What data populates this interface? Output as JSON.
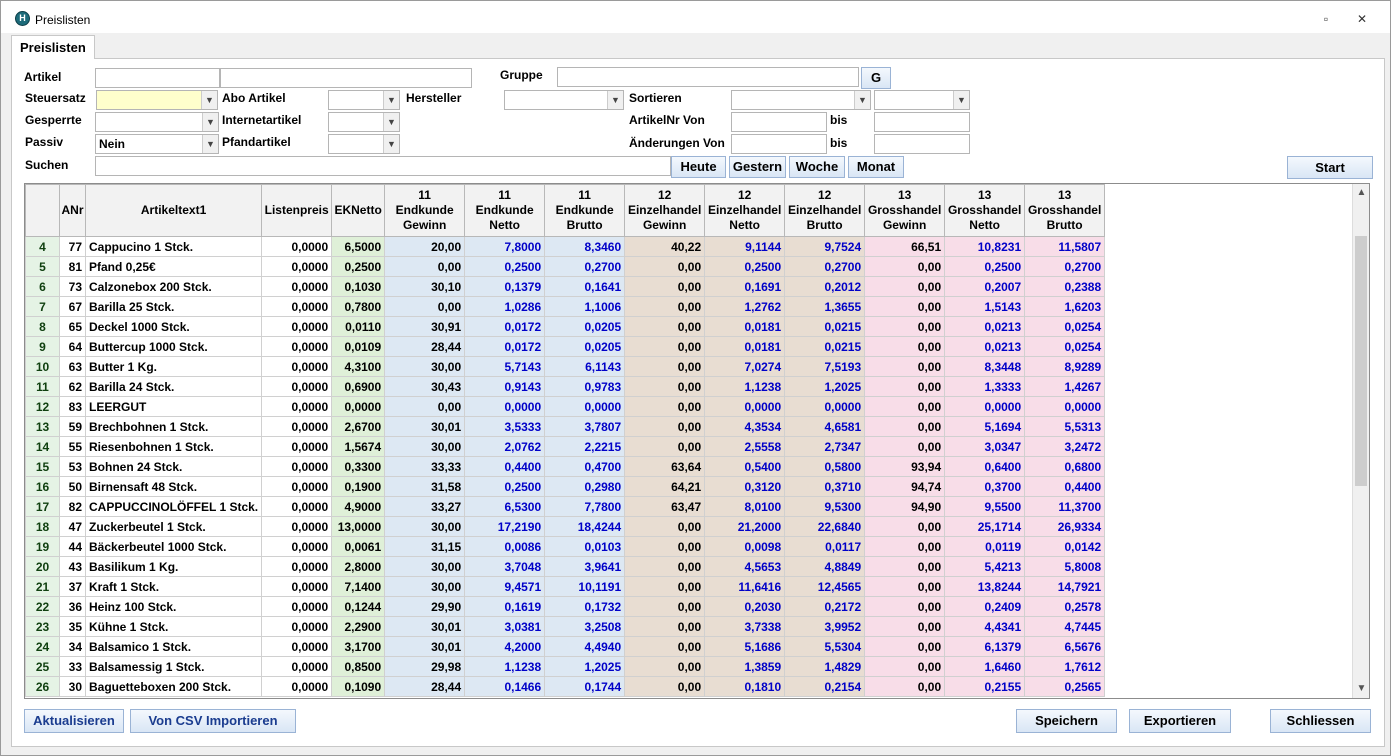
{
  "window": {
    "title": "Preislisten",
    "app_icon": "H"
  },
  "tabs": [
    {
      "label": "Preislisten"
    }
  ],
  "filters": {
    "artikel_label": "Artikel",
    "gruppe_label": "Gruppe",
    "g_button": "G",
    "steuersatz_label": "Steuersatz",
    "abo_artikel_label": "Abo Artikel",
    "hersteller_label": "Hersteller",
    "sortieren_label": "Sortieren",
    "gesperrte_label": "Gesperrte",
    "internetartikel_label": "Internetartikel",
    "artikelnr_von_label": "ArtikelNr Von",
    "bis_label_1": "bis",
    "passiv_label": "Passiv",
    "passiv_value": "Nein",
    "pfandartikel_label": "Pfandartikel",
    "aenderungen_von_label": "Änderungen Von",
    "bis_label_2": "bis",
    "suchen_label": "Suchen",
    "heute": "Heute",
    "gestern": "Gestern",
    "woche": "Woche",
    "monat": "Monat",
    "start": "Start"
  },
  "table": {
    "headers": [
      [
        "ANr"
      ],
      [
        "Artikeltext1"
      ],
      [
        "Listenpreis"
      ],
      [
        "EKNetto"
      ],
      [
        "11",
        "Endkunde",
        "Gewinn"
      ],
      [
        "11",
        "Endkunde",
        "Netto"
      ],
      [
        "11",
        "Endkunde",
        "Brutto"
      ],
      [
        "12",
        "Einzelhandel",
        "Gewinn"
      ],
      [
        "12",
        "Einzelhandel",
        "Netto"
      ],
      [
        "12",
        "Einzelhandel",
        "Brutto"
      ],
      [
        "13",
        "Grosshandel",
        "Gewinn"
      ],
      [
        "13",
        "Grosshandel",
        "Netto"
      ],
      [
        "13",
        "Grosshandel",
        "Brutto"
      ]
    ],
    "rows": [
      [
        "4",
        "77",
        "Cappucino 1 Stck.",
        "0,0000",
        "6,5000",
        "20,00",
        "7,8000",
        "8,3460",
        "40,22",
        "9,1144",
        "9,7524",
        "66,51",
        "10,8231",
        "11,5807"
      ],
      [
        "5",
        "81",
        "Pfand 0,25€",
        "0,0000",
        "0,2500",
        "0,00",
        "0,2500",
        "0,2700",
        "0,00",
        "0,2500",
        "0,2700",
        "0,00",
        "0,2500",
        "0,2700"
      ],
      [
        "6",
        "73",
        "Calzonebox 200 Stck.",
        "0,0000",
        "0,1030",
        "30,10",
        "0,1379",
        "0,1641",
        "0,00",
        "0,1691",
        "0,2012",
        "0,00",
        "0,2007",
        "0,2388"
      ],
      [
        "7",
        "67",
        "Barilla 25 Stck.",
        "0,0000",
        "0,7800",
        "0,00",
        "1,0286",
        "1,1006",
        "0,00",
        "1,2762",
        "1,3655",
        "0,00",
        "1,5143",
        "1,6203"
      ],
      [
        "8",
        "65",
        "Deckel 1000 Stck.",
        "0,0000",
        "0,0110",
        "30,91",
        "0,0172",
        "0,0205",
        "0,00",
        "0,0181",
        "0,0215",
        "0,00",
        "0,0213",
        "0,0254"
      ],
      [
        "9",
        "64",
        "Buttercup 1000 Stck.",
        "0,0000",
        "0,0109",
        "28,44",
        "0,0172",
        "0,0205",
        "0,00",
        "0,0181",
        "0,0215",
        "0,00",
        "0,0213",
        "0,0254"
      ],
      [
        "10",
        "63",
        "Butter 1 Kg.",
        "0,0000",
        "4,3100",
        "30,00",
        "5,7143",
        "6,1143",
        "0,00",
        "7,0274",
        "7,5193",
        "0,00",
        "8,3448",
        "8,9289"
      ],
      [
        "11",
        "62",
        "Barilla 24 Stck.",
        "0,0000",
        "0,6900",
        "30,43",
        "0,9143",
        "0,9783",
        "0,00",
        "1,1238",
        "1,2025",
        "0,00",
        "1,3333",
        "1,4267"
      ],
      [
        "12",
        "83",
        "LEERGUT",
        "0,0000",
        "0,0000",
        "0,00",
        "0,0000",
        "0,0000",
        "0,00",
        "0,0000",
        "0,0000",
        "0,00",
        "0,0000",
        "0,0000"
      ],
      [
        "13",
        "59",
        "Brechbohnen 1 Stck.",
        "0,0000",
        "2,6700",
        "30,01",
        "3,5333",
        "3,7807",
        "0,00",
        "4,3534",
        "4,6581",
        "0,00",
        "5,1694",
        "5,5313"
      ],
      [
        "14",
        "55",
        "Riesenbohnen 1 Stck.",
        "0,0000",
        "1,5674",
        "30,00",
        "2,0762",
        "2,2215",
        "0,00",
        "2,5558",
        "2,7347",
        "0,00",
        "3,0347",
        "3,2472"
      ],
      [
        "15",
        "53",
        "Bohnen 24 Stck.",
        "0,0000",
        "0,3300",
        "33,33",
        "0,4400",
        "0,4700",
        "63,64",
        "0,5400",
        "0,5800",
        "93,94",
        "0,6400",
        "0,6800"
      ],
      [
        "16",
        "50",
        "Birnensaft 48 Stck.",
        "0,0000",
        "0,1900",
        "31,58",
        "0,2500",
        "0,2980",
        "64,21",
        "0,3120",
        "0,3710",
        "94,74",
        "0,3700",
        "0,4400"
      ],
      [
        "17",
        "82",
        "CAPPUCCINOLÖFFEL 1 Stck.",
        "0,0000",
        "4,9000",
        "33,27",
        "6,5300",
        "7,7800",
        "63,47",
        "8,0100",
        "9,5300",
        "94,90",
        "9,5500",
        "11,3700"
      ],
      [
        "18",
        "47",
        "Zuckerbeutel 1 Stck.",
        "0,0000",
        "13,0000",
        "30,00",
        "17,2190",
        "18,4244",
        "0,00",
        "21,2000",
        "22,6840",
        "0,00",
        "25,1714",
        "26,9334"
      ],
      [
        "19",
        "44",
        "Bäckerbeutel 1000 Stck.",
        "0,0000",
        "0,0061",
        "31,15",
        "0,0086",
        "0,0103",
        "0,00",
        "0,0098",
        "0,0117",
        "0,00",
        "0,0119",
        "0,0142"
      ],
      [
        "20",
        "43",
        "Basilikum 1 Kg.",
        "0,0000",
        "2,8000",
        "30,00",
        "3,7048",
        "3,9641",
        "0,00",
        "4,5653",
        "4,8849",
        "0,00",
        "5,4213",
        "5,8008"
      ],
      [
        "21",
        "37",
        "Kraft 1 Stck.",
        "0,0000",
        "7,1400",
        "30,00",
        "9,4571",
        "10,1191",
        "0,00",
        "11,6416",
        "12,4565",
        "0,00",
        "13,8244",
        "14,7921"
      ],
      [
        "22",
        "36",
        "Heinz 100 Stck.",
        "0,0000",
        "0,1244",
        "29,90",
        "0,1619",
        "0,1732",
        "0,00",
        "0,2030",
        "0,2172",
        "0,00",
        "0,2409",
        "0,2578"
      ],
      [
        "23",
        "35",
        "Kühne 1 Stck.",
        "0,0000",
        "2,2900",
        "30,01",
        "3,0381",
        "3,2508",
        "0,00",
        "3,7338",
        "3,9952",
        "0,00",
        "4,4341",
        "4,7445"
      ],
      [
        "24",
        "34",
        "Balsamico 1 Stck.",
        "0,0000",
        "3,1700",
        "30,01",
        "4,2000",
        "4,4940",
        "0,00",
        "5,1686",
        "5,5304",
        "0,00",
        "6,1379",
        "6,5676"
      ],
      [
        "25",
        "33",
        "Balsamessig 1 Stck.",
        "0,0000",
        "0,8500",
        "29,98",
        "1,1238",
        "1,2025",
        "0,00",
        "1,3859",
        "1,4829",
        "0,00",
        "1,6460",
        "1,7612"
      ],
      [
        "26",
        "30",
        "Baguetteboxen 200 Stck.",
        "0,0000",
        "0,1090",
        "28,44",
        "0,1466",
        "0,1744",
        "0,00",
        "0,1810",
        "0,2154",
        "0,00",
        "0,2155",
        "0,2565"
      ]
    ]
  },
  "footer": {
    "aktualisieren": "Aktualisieren",
    "csv_import": "Von CSV Importieren",
    "speichern": "Speichern",
    "exportieren": "Exportieren",
    "schliessen": "Schliessen"
  },
  "colors": {
    "ek_column": "#dff0d8",
    "endkunde_columns": "#dde8f3",
    "einzelhandel_columns": "#e8ddd2",
    "grosshandel_columns": "#f8dde8",
    "price_text": "#0000c8"
  }
}
